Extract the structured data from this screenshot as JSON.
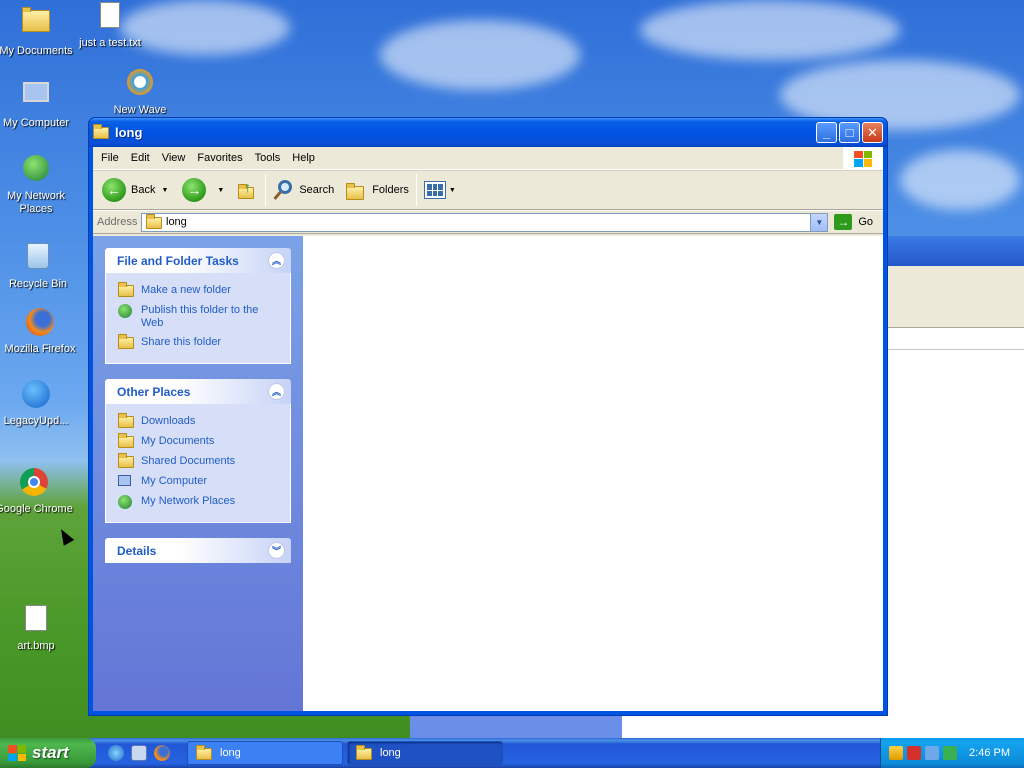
{
  "desktop": {
    "icons": [
      {
        "label": "My Documents",
        "icon": "my-documents-icon"
      },
      {
        "label": "just a test.txt",
        "icon": "text-file-icon"
      },
      {
        "label": "New Wave",
        "icon": "media-file-icon"
      },
      {
        "label": "My Computer",
        "icon": "computer-icon"
      },
      {
        "label": "My Network Places",
        "icon": "network-icon"
      },
      {
        "label": "Recycle Bin",
        "icon": "recycle-bin-icon"
      },
      {
        "label": "Mozilla Firefox",
        "icon": "firefox-icon"
      },
      {
        "label": "LegacyUpd...",
        "icon": "update-icon"
      },
      {
        "label": "Google Chrome",
        "icon": "chrome-icon"
      },
      {
        "label": "art.bmp",
        "icon": "bitmap-icon"
      }
    ]
  },
  "window": {
    "title": "long",
    "menu": [
      "File",
      "Edit",
      "View",
      "Favorites",
      "Tools",
      "Help"
    ],
    "toolbar": {
      "back": "Back",
      "search": "Search",
      "folders": "Folders"
    },
    "address": {
      "label": "Address",
      "value": "long",
      "go": "Go"
    },
    "tasks": {
      "file_folder": {
        "title": "File and Folder Tasks",
        "items": [
          "Make a new folder",
          "Publish this folder to the Web",
          "Share this folder"
        ]
      },
      "other_places": {
        "title": "Other Places",
        "items": [
          "Downloads",
          "My Documents",
          "Shared Documents",
          "My Computer",
          "My Network Places"
        ]
      },
      "details": {
        "title": "Details"
      }
    }
  },
  "taskbar": {
    "start": "start",
    "tasks": [
      "long",
      "long"
    ],
    "clock": "2:46 PM"
  },
  "colors": {
    "title_blue": "#0054e3",
    "link_blue": "#215dc6",
    "taskpane": "#7ba2e7",
    "start_green": "#3c9a3c"
  }
}
